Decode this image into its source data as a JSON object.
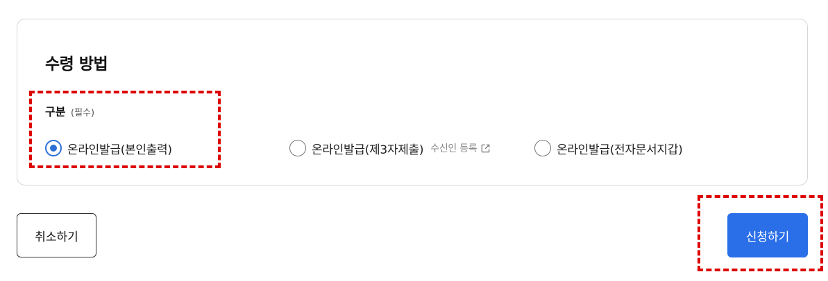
{
  "section": {
    "title": "수령 방법",
    "group_label": "구분",
    "group_required": "(필수)",
    "options": [
      {
        "label": "온라인발급(본인출력)",
        "selected": true
      },
      {
        "label": "온라인발급(제3자제출)",
        "selected": false,
        "link_label": "수신인 등록"
      },
      {
        "label": "온라인발급(전자문서지갑)",
        "selected": false
      }
    ]
  },
  "actions": {
    "cancel_label": "취소하기",
    "apply_label": "신청하기"
  },
  "colors": {
    "accent": "#2b6fe8",
    "highlight_dash": "#dd0000"
  },
  "icons": {
    "external_link": "external-link-icon"
  }
}
